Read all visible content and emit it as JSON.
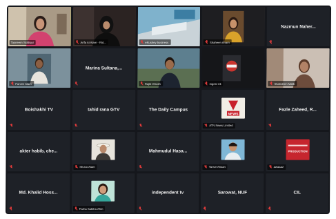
{
  "participants": [
    {
      "label": "Tasneem Siddiqui",
      "type": "video",
      "active": true
    },
    {
      "label": "Arifa Ai Alam - Rid...",
      "type": "video"
    },
    {
      "label": "eKushey business",
      "type": "video"
    },
    {
      "label": "Shaheen Anam",
      "type": "video"
    },
    {
      "center": "Nazmun Naher...",
      "type": "name"
    },
    {
      "label": "Parvez Alam",
      "type": "video"
    },
    {
      "center": "Marina Sultana,...",
      "type": "name"
    },
    {
      "label": "Rajib Ghosh",
      "type": "video"
    },
    {
      "label": "ingest 24",
      "type": "video"
    },
    {
      "label": "Shahdeen Malik",
      "type": "video"
    },
    {
      "center": "Boishakhi TV",
      "type": "name"
    },
    {
      "center": "tahid rana GTV",
      "type": "name"
    },
    {
      "center": "The Daily Campus",
      "type": "name"
    },
    {
      "label": "ATN News Limited",
      "type": "logo",
      "logo_text": "NEWS"
    },
    {
      "center": "Fazle Zaheed, R...",
      "type": "name"
    },
    {
      "center": "akter habib, che...",
      "type": "name"
    },
    {
      "label": "Shuvo Alam",
      "type": "avatar"
    },
    {
      "center": "Mahmudul Hasa...",
      "type": "name"
    },
    {
      "label": "Tanvir Ahsan",
      "type": "avatar"
    },
    {
      "label": "awaaaz",
      "type": "logo",
      "logo_text": "PRODUCTION"
    },
    {
      "center": "Md. Khalid Hoss...",
      "type": "name"
    },
    {
      "label": "Farha Sabiha Afrin",
      "type": "avatar"
    },
    {
      "center": "independent tv",
      "type": "name"
    },
    {
      "center": "Sarowat, NUF",
      "type": "name"
    },
    {
      "center": "CIL",
      "type": "name"
    }
  ],
  "colors": {
    "active_border": "#c9d44a",
    "muted_mic": "#e03b3b",
    "grid_bg": "#15171c",
    "tile_bg": "#1e2127"
  }
}
